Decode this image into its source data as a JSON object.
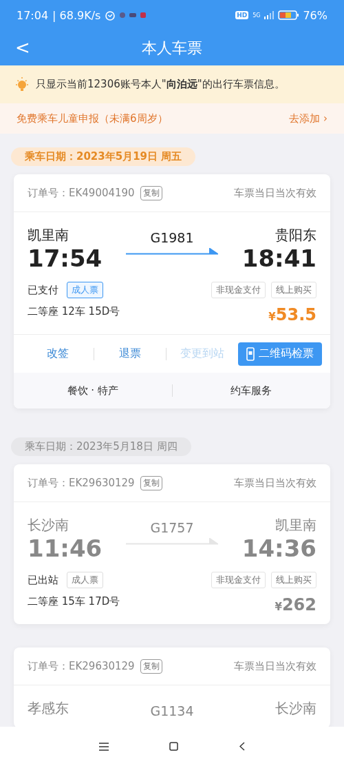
{
  "status_bar": {
    "time": "17:04",
    "speed": "| 68.9K/s",
    "hd": "HD",
    "network": "5G",
    "battery": "76%"
  },
  "header": {
    "back": "<",
    "title": "本人车票"
  },
  "notice": {
    "text": "只显示当前12306账号本人\"**向泊远**\"的出行车票信息。"
  },
  "child_banner": {
    "text": "免费乘车儿童申报（未满6周岁）",
    "action": "去添加",
    "chevron": "›"
  },
  "groups": [
    {
      "date": "乘车日期：2023年5月19日 周五",
      "active": true,
      "tickets": [
        {
          "order_label": "订单号：",
          "order_no": "EK49004190",
          "copy": "复制",
          "validity": "车票当日当次有效",
          "from": "凯里南",
          "depart": "17:54",
          "train": "G1981",
          "to": "贵阳东",
          "arrive": "18:41",
          "status": "已支付",
          "ticket_type": "成人票",
          "tags": [
            "非现金支付",
            "线上购买"
          ],
          "seat": "二等座 12车 15D号",
          "currency": "¥",
          "price": "53.5",
          "active": true,
          "actions": [
            {
              "label": "改签",
              "kind": "link"
            },
            {
              "label": "退票",
              "kind": "link"
            },
            {
              "label": "变更到站",
              "kind": "disabled"
            },
            {
              "label": "二维码检票",
              "kind": "primary"
            }
          ],
          "services": [
            "餐饮 · 特产",
            "约车服务"
          ]
        }
      ]
    },
    {
      "date": "乘车日期：2023年5月18日 周四",
      "active": false,
      "tickets": [
        {
          "order_label": "订单号：",
          "order_no": "EK29630129",
          "copy": "复制",
          "validity": "车票当日当次有效",
          "from": "长沙南",
          "depart": "11:46",
          "train": "G1757",
          "to": "凯里南",
          "arrive": "14:36",
          "status": "已出站",
          "ticket_type": "成人票",
          "tags": [
            "非现金支付",
            "线上购买"
          ],
          "seat": "二等座 15车 17D号",
          "currency": "¥",
          "price": "262",
          "active": false
        },
        {
          "order_label": "订单号：",
          "order_no": "EK29630129",
          "copy": "复制",
          "validity": "车票当日当次有效",
          "from": "孝感东",
          "train": "G1134",
          "to": "长沙南",
          "active": false
        }
      ]
    }
  ]
}
